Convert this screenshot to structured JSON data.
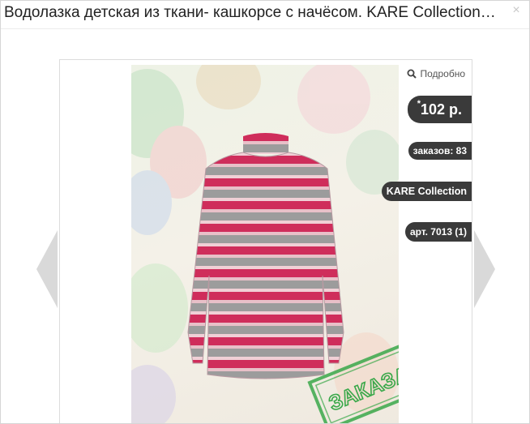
{
  "modal": {
    "title": "Водолазка детская из ткани- кашкорсе с начёсом. KARE Collection а...",
    "close_icon": "×"
  },
  "product": {
    "details_label": "Подробно",
    "price_mark": "*",
    "price": "102 р.",
    "orders": "заказов: 83",
    "brand": "KARE Collection",
    "article": "арт. 7013 (1)",
    "stamp_text": "ЗАКАЗАНО"
  },
  "colors": {
    "badge_bg": "#3a3a3a",
    "stamp": "#3aa84a",
    "stripe_red": "#cc2f5a",
    "stripe_gray": "#9a9a9a"
  }
}
